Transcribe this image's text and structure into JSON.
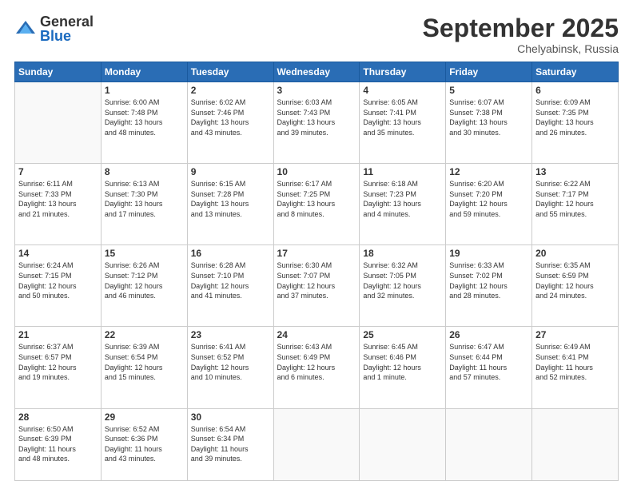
{
  "logo": {
    "general": "General",
    "blue": "Blue"
  },
  "header": {
    "month": "September 2025",
    "location": "Chelyabinsk, Russia"
  },
  "weekdays": [
    "Sunday",
    "Monday",
    "Tuesday",
    "Wednesday",
    "Thursday",
    "Friday",
    "Saturday"
  ],
  "weeks": [
    [
      {
        "day": "",
        "text": ""
      },
      {
        "day": "1",
        "text": "Sunrise: 6:00 AM\nSunset: 7:48 PM\nDaylight: 13 hours\nand 48 minutes."
      },
      {
        "day": "2",
        "text": "Sunrise: 6:02 AM\nSunset: 7:46 PM\nDaylight: 13 hours\nand 43 minutes."
      },
      {
        "day": "3",
        "text": "Sunrise: 6:03 AM\nSunset: 7:43 PM\nDaylight: 13 hours\nand 39 minutes."
      },
      {
        "day": "4",
        "text": "Sunrise: 6:05 AM\nSunset: 7:41 PM\nDaylight: 13 hours\nand 35 minutes."
      },
      {
        "day": "5",
        "text": "Sunrise: 6:07 AM\nSunset: 7:38 PM\nDaylight: 13 hours\nand 30 minutes."
      },
      {
        "day": "6",
        "text": "Sunrise: 6:09 AM\nSunset: 7:35 PM\nDaylight: 13 hours\nand 26 minutes."
      }
    ],
    [
      {
        "day": "7",
        "text": "Sunrise: 6:11 AM\nSunset: 7:33 PM\nDaylight: 13 hours\nand 21 minutes."
      },
      {
        "day": "8",
        "text": "Sunrise: 6:13 AM\nSunset: 7:30 PM\nDaylight: 13 hours\nand 17 minutes."
      },
      {
        "day": "9",
        "text": "Sunrise: 6:15 AM\nSunset: 7:28 PM\nDaylight: 13 hours\nand 13 minutes."
      },
      {
        "day": "10",
        "text": "Sunrise: 6:17 AM\nSunset: 7:25 PM\nDaylight: 13 hours\nand 8 minutes."
      },
      {
        "day": "11",
        "text": "Sunrise: 6:18 AM\nSunset: 7:23 PM\nDaylight: 13 hours\nand 4 minutes."
      },
      {
        "day": "12",
        "text": "Sunrise: 6:20 AM\nSunset: 7:20 PM\nDaylight: 12 hours\nand 59 minutes."
      },
      {
        "day": "13",
        "text": "Sunrise: 6:22 AM\nSunset: 7:17 PM\nDaylight: 12 hours\nand 55 minutes."
      }
    ],
    [
      {
        "day": "14",
        "text": "Sunrise: 6:24 AM\nSunset: 7:15 PM\nDaylight: 12 hours\nand 50 minutes."
      },
      {
        "day": "15",
        "text": "Sunrise: 6:26 AM\nSunset: 7:12 PM\nDaylight: 12 hours\nand 46 minutes."
      },
      {
        "day": "16",
        "text": "Sunrise: 6:28 AM\nSunset: 7:10 PM\nDaylight: 12 hours\nand 41 minutes."
      },
      {
        "day": "17",
        "text": "Sunrise: 6:30 AM\nSunset: 7:07 PM\nDaylight: 12 hours\nand 37 minutes."
      },
      {
        "day": "18",
        "text": "Sunrise: 6:32 AM\nSunset: 7:05 PM\nDaylight: 12 hours\nand 32 minutes."
      },
      {
        "day": "19",
        "text": "Sunrise: 6:33 AM\nSunset: 7:02 PM\nDaylight: 12 hours\nand 28 minutes."
      },
      {
        "day": "20",
        "text": "Sunrise: 6:35 AM\nSunset: 6:59 PM\nDaylight: 12 hours\nand 24 minutes."
      }
    ],
    [
      {
        "day": "21",
        "text": "Sunrise: 6:37 AM\nSunset: 6:57 PM\nDaylight: 12 hours\nand 19 minutes."
      },
      {
        "day": "22",
        "text": "Sunrise: 6:39 AM\nSunset: 6:54 PM\nDaylight: 12 hours\nand 15 minutes."
      },
      {
        "day": "23",
        "text": "Sunrise: 6:41 AM\nSunset: 6:52 PM\nDaylight: 12 hours\nand 10 minutes."
      },
      {
        "day": "24",
        "text": "Sunrise: 6:43 AM\nSunset: 6:49 PM\nDaylight: 12 hours\nand 6 minutes."
      },
      {
        "day": "25",
        "text": "Sunrise: 6:45 AM\nSunset: 6:46 PM\nDaylight: 12 hours\nand 1 minute."
      },
      {
        "day": "26",
        "text": "Sunrise: 6:47 AM\nSunset: 6:44 PM\nDaylight: 11 hours\nand 57 minutes."
      },
      {
        "day": "27",
        "text": "Sunrise: 6:49 AM\nSunset: 6:41 PM\nDaylight: 11 hours\nand 52 minutes."
      }
    ],
    [
      {
        "day": "28",
        "text": "Sunrise: 6:50 AM\nSunset: 6:39 PM\nDaylight: 11 hours\nand 48 minutes."
      },
      {
        "day": "29",
        "text": "Sunrise: 6:52 AM\nSunset: 6:36 PM\nDaylight: 11 hours\nand 43 minutes."
      },
      {
        "day": "30",
        "text": "Sunrise: 6:54 AM\nSunset: 6:34 PM\nDaylight: 11 hours\nand 39 minutes."
      },
      {
        "day": "",
        "text": ""
      },
      {
        "day": "",
        "text": ""
      },
      {
        "day": "",
        "text": ""
      },
      {
        "day": "",
        "text": ""
      }
    ]
  ]
}
